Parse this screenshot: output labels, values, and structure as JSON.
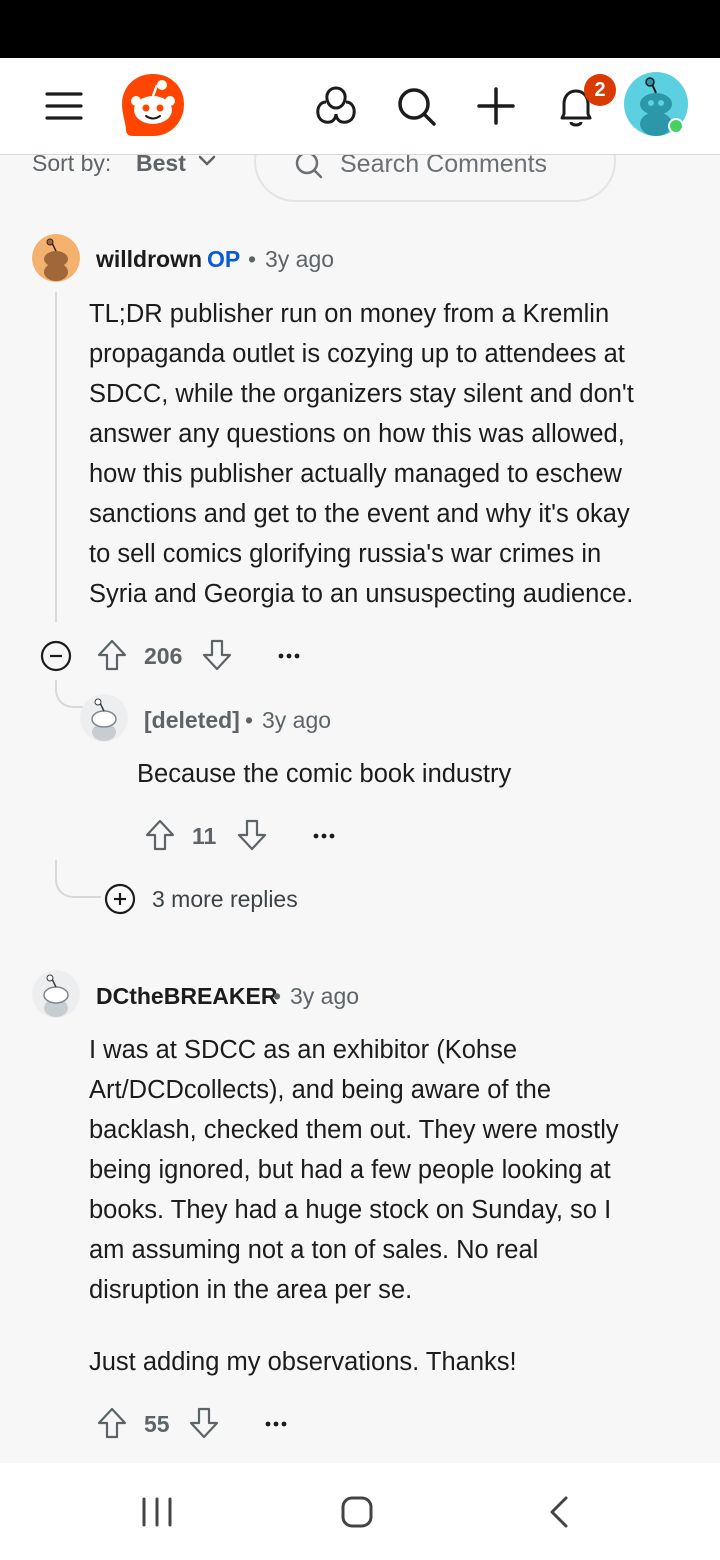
{
  "header": {
    "notification_count": "2",
    "icons": [
      "menu-icon",
      "reddit-logo",
      "communities-icon",
      "search-icon",
      "create-icon",
      "bell-icon",
      "user-avatar"
    ]
  },
  "sort": {
    "label": "Sort by:",
    "value": "Best",
    "search_placeholder": "Search Comments"
  },
  "comments": [
    {
      "author": "willdrown",
      "op_badge": "OP",
      "time": "3y ago",
      "body_lines": [
        "TL;DR publisher run on money from a Kremlin",
        "propaganda outlet is cozying up to attendees at",
        "SDCC, while the organizers stay silent and don't",
        "answer any questions on how this was allowed,",
        "how this publisher actually managed to eschew",
        "sanctions and get to the event and why it's okay",
        "to sell comics glorifying russia's war crimes in",
        "Syria and Georgia to an unsuspecting audience."
      ],
      "votes": "206",
      "replies": [
        {
          "author": "[deleted]",
          "time": "3y ago",
          "body": "Because the comic book industry",
          "votes": "11"
        }
      ],
      "more_replies": "3 more replies"
    },
    {
      "author": "DCtheBREAKER",
      "time": "3y ago",
      "body_lines": [
        "I was at SDCC as an exhibitor (Kohse",
        "Art/DCDcollects), and being aware of the",
        "backlash, checked them out. They were mostly",
        "being ignored, but had a few people looking at",
        "books. They had a huge stock on Sunday, so I",
        "am assuming not a ton of sales. No real",
        "disruption in the area per se."
      ],
      "body_line_last": "Just adding my observations. Thanks!",
      "votes": "55"
    }
  ],
  "colors": {
    "reddit_orange": "#ff4500",
    "op_blue": "#0a5ad4",
    "badge_red": "#d93a00",
    "online_green": "#46d160",
    "background": "#f7f7f8"
  }
}
